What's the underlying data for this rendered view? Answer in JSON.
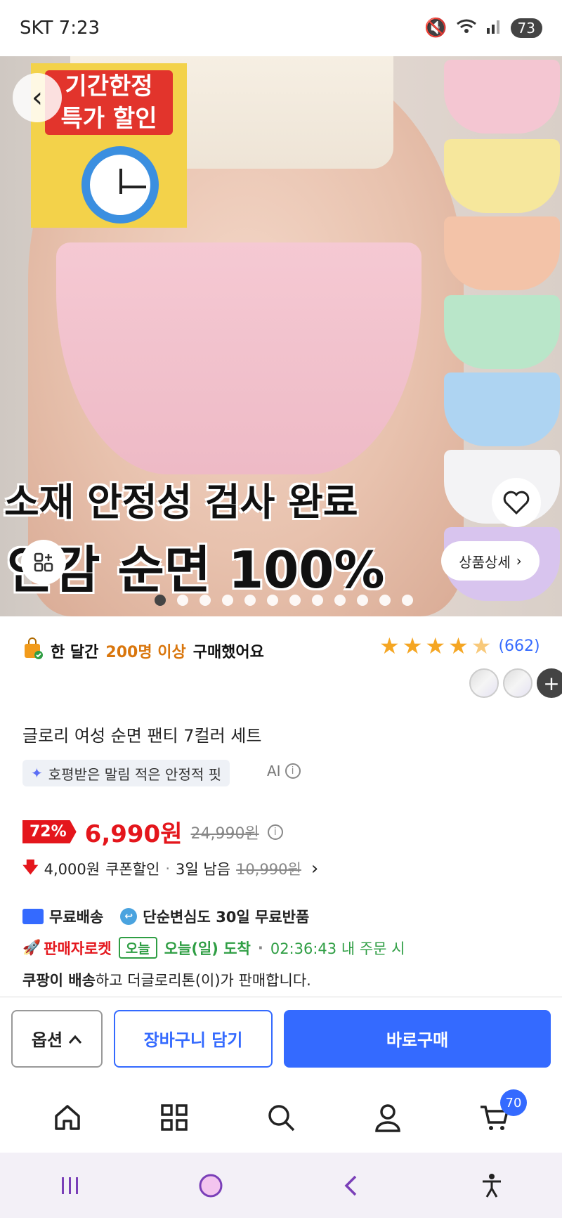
{
  "status_bar": {
    "carrier_time": "SKT 7:23",
    "battery": "73"
  },
  "hero": {
    "promo_line1": "기간한정",
    "promo_line2": "특가 할인",
    "headline1": "소재 안정성 검사 완료",
    "headline2": "안감 순면 100%",
    "detail_button": "상품상세",
    "swatch_colors": [
      "#f4c6d2",
      "#f6e79c",
      "#f3c3a8",
      "#b9e6c9",
      "#aed4f2",
      "#f3f3f5",
      "#d8c4ee"
    ]
  },
  "purchase_info": {
    "pre": "한 달간",
    "highlight": "200명 이상",
    "post": "구매했어요"
  },
  "rating": {
    "stars": 4.5,
    "review_count": "(662)"
  },
  "product": {
    "title": "글로리 여성 순면 팬티 7컬러 세트",
    "ai_summary": "호평받은 말림 적은 안정적 핏",
    "ai_label": "AI"
  },
  "price": {
    "discount": "72%",
    "sale": "6,990원",
    "original": "24,990원",
    "coupon_amount": "4,000원",
    "coupon_label": "쿠폰할인",
    "coupon_separator": "·",
    "coupon_days": "3일 남음",
    "coupon_original": "10,990원"
  },
  "shipping": {
    "free_shipping": "무료배송",
    "return": "단순변심도 30일 무료반품",
    "rocket": "판매자로켓",
    "today_badge": "오늘",
    "arrival": "오늘(일) 도착",
    "separator": "·",
    "order_by": "02:36:43 내 주문 시",
    "seller_bold": "쿠팡이 배송",
    "seller_rest": "하고 더글로리톤(이)가 판매합니다."
  },
  "actions": {
    "option": "옵션",
    "cart": "장바구니 담기",
    "buy": "바로구매"
  },
  "bottom_nav": {
    "cart_count": "70"
  },
  "colors": {
    "accent": "#346aff",
    "sale_red": "#e4161c",
    "orange": "#d9760d",
    "green": "#2f9e44"
  }
}
